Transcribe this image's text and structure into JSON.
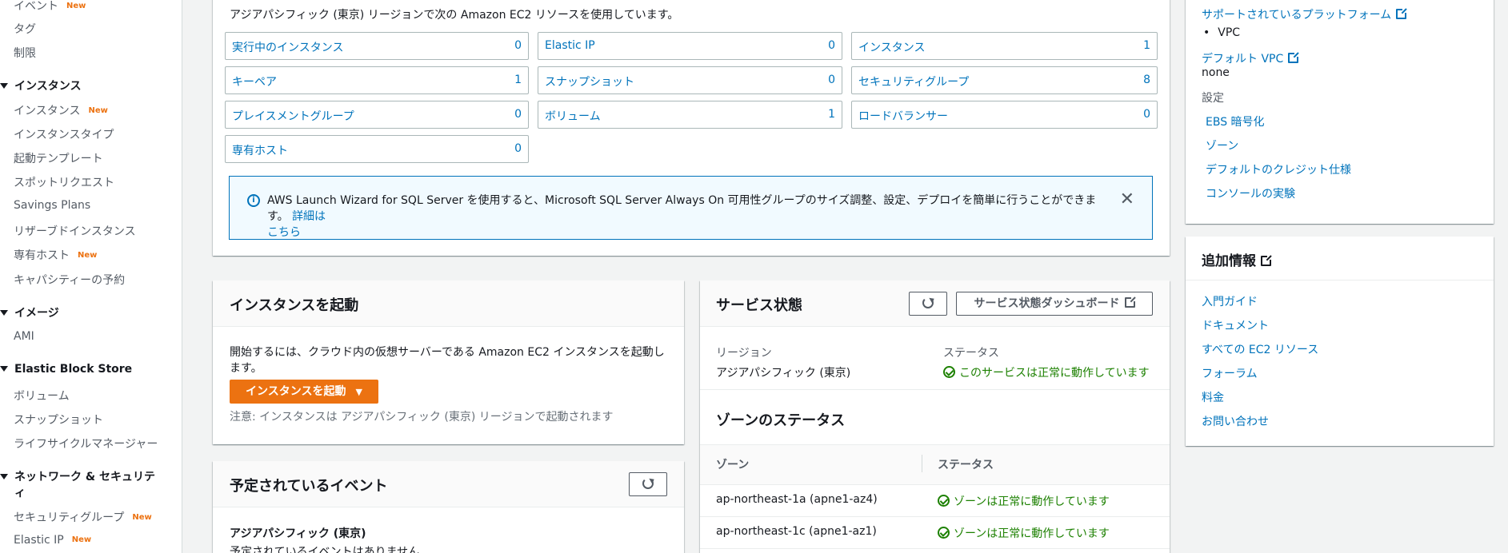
{
  "sidebar": {
    "items": [
      {
        "label": "イベント",
        "new": "New"
      },
      {
        "label": "タグ"
      },
      {
        "label": "制限"
      }
    ],
    "instances_group": "インスタンス",
    "instances_items": [
      {
        "label": "インスタンス",
        "new": "New"
      },
      {
        "label": "インスタンスタイプ"
      },
      {
        "label": "起動テンプレート"
      },
      {
        "label": "スポットリクエスト"
      },
      {
        "label": "Savings Plans"
      },
      {
        "label": "リザーブドインスタンス"
      },
      {
        "label": "専有ホスト",
        "new": "New"
      },
      {
        "label": "キャパシティーの予約"
      }
    ],
    "images_group": "イメージ",
    "images_items": [
      {
        "label": "AMI"
      }
    ],
    "ebs_group": "Elastic Block Store",
    "ebs_items": [
      {
        "label": "ボリューム"
      },
      {
        "label": "スナップショット"
      },
      {
        "label": "ライフサイクルマネージャー"
      }
    ],
    "network_group_line1": "ネットワーク & セキュリテ",
    "network_group_line2": "ィ",
    "network_items": [
      {
        "label": "セキュリティグループ",
        "new": "New"
      },
      {
        "label": "Elastic IP",
        "new": "New"
      }
    ]
  },
  "resources": {
    "intro": "アジアパシフィック (東京) リージョンで次の Amazon EC2 リソースを使用しています。",
    "items": [
      {
        "label": "実行中のインスタンス",
        "count": "0"
      },
      {
        "label": "Elastic IP",
        "count": "0"
      },
      {
        "label": "インスタンス",
        "count": "1"
      },
      {
        "label": "キーペア",
        "count": "1"
      },
      {
        "label": "スナップショット",
        "count": "0"
      },
      {
        "label": "セキュリティグループ",
        "count": "8"
      },
      {
        "label": "プレイスメントグループ",
        "count": "0"
      },
      {
        "label": "ボリューム",
        "count": "1"
      },
      {
        "label": "ロードバランサー",
        "count": "0"
      },
      {
        "label": "専有ホスト",
        "count": "0"
      }
    ],
    "info_text": "AWS Launch Wizard for SQL Server を使用すると、Microsoft SQL Server Always On 可用性グループのサイズ調整、設定、デプロイを簡単に行うことができます。",
    "info_link_part1": "詳細は",
    "info_link_part2": "こちら"
  },
  "launch": {
    "title": "インスタンスを起動",
    "desc": "開始するには、クラウド内の仮想サーバーである Amazon EC2 インスタンスを起動します。",
    "button": "インスタンスを起動",
    "note": "注意: インスタンスは アジアパシフィック (東京) リージョンで起動されます"
  },
  "events": {
    "title": "予定されているイベント",
    "region": "アジアパシフィック (東京)",
    "empty": "予定されているイベントはありません"
  },
  "service": {
    "title": "サービス状態",
    "dashboard_button": "サービス状態ダッシュボード",
    "region_label": "リージョン",
    "region_value": "アジアパシフィック (東京)",
    "status_label": "ステータス",
    "status_value": "このサービスは正常に動作しています",
    "zone_title": "ゾーンのステータス",
    "zone_col": "ゾーン",
    "status_col": "ステータス",
    "zones": [
      {
        "zone": "ap-northeast-1a (apne1-az4)",
        "status": "ゾーンは正常に動作しています"
      },
      {
        "zone": "ap-northeast-1c (apne1-az1)",
        "status": "ゾーンは正常に動作しています"
      }
    ]
  },
  "attributes": {
    "supported_platforms": "サポートされているプラットフォーム",
    "vpc_bullet": "VPC",
    "default_vpc": "デフォルト VPC",
    "default_vpc_value": "none",
    "settings_label": "設定",
    "settings_links": [
      "EBS 暗号化",
      "ゾーン",
      "デフォルトのクレジット仕様",
      "コンソールの実験"
    ]
  },
  "additional": {
    "title": "追加情報",
    "links": [
      "入門ガイド",
      "ドキュメント",
      "すべての EC2 リソース",
      "フォーラム",
      "料金",
      "お問い合わせ"
    ]
  }
}
